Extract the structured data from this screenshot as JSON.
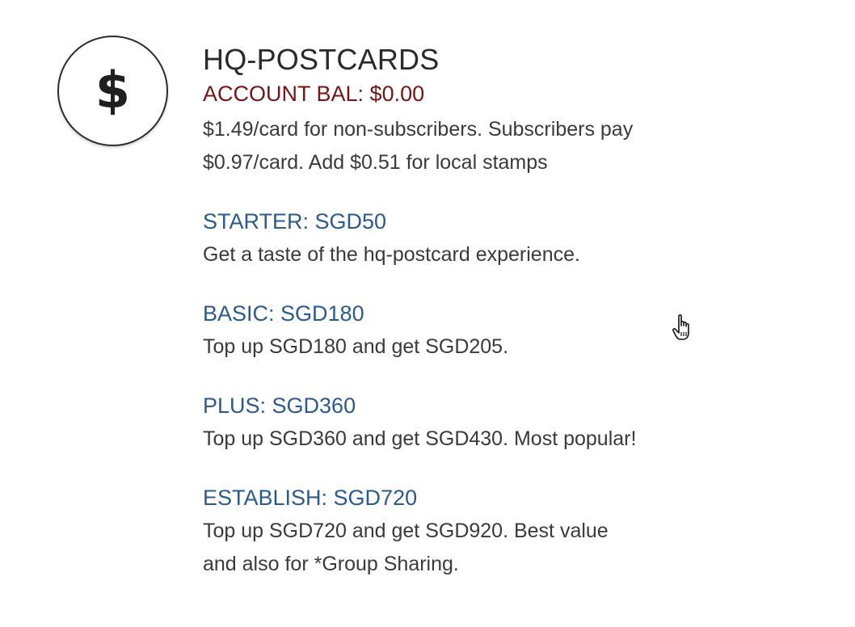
{
  "header": {
    "icon": "dollar-icon",
    "icon_glyph": "$",
    "title": "HQ-POSTCARDS",
    "balance": "ACCOUNT BAL: $0.00",
    "description_line1": "$1.49/card for non-subscribers. Subscribers pay",
    "description_line2": "$0.97/card. Add $0.51 for local stamps"
  },
  "plans": [
    {
      "name": "STARTER: SGD50",
      "description": "Get a taste of the hq-postcard experience."
    },
    {
      "name": "BASIC: SGD180",
      "description": "Top up SGD180 and get SGD205."
    },
    {
      "name": "PLUS: SGD360",
      "description": "Top up SGD360 and get SGD430. Most popular!"
    },
    {
      "name": "ESTABLISH: SGD720",
      "description_line1": "Top up SGD720 and get SGD920. Best value",
      "description_line2": "and also for *Group Sharing."
    }
  ],
  "colors": {
    "title": "#2a2a2a",
    "balance": "#7a1414",
    "plan_name": "#2a5a8f",
    "body_text": "#3a3a3a"
  },
  "cursor": "hand-pointer-icon"
}
